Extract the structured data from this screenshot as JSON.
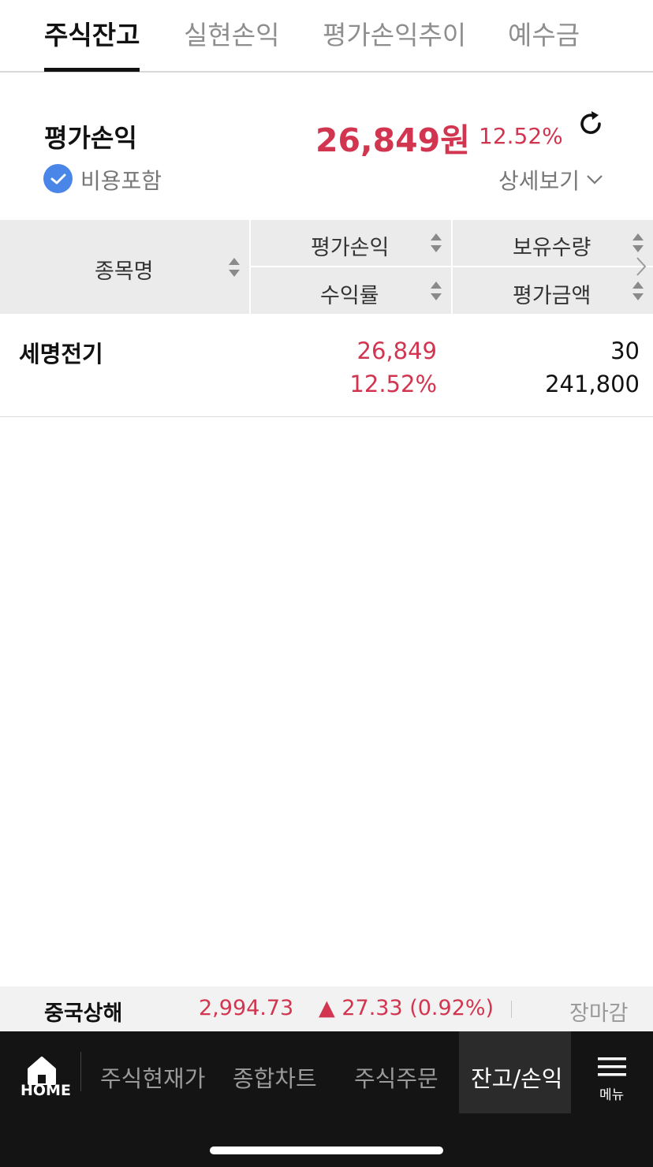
{
  "tabs": [
    "주식잔고",
    "실현손익",
    "평가손익추이",
    "예수금"
  ],
  "summary": {
    "title": "평가손익",
    "amount": "26,849원",
    "rate": "12.52%",
    "include_fee_label": "비용포함",
    "detail_label": "상세보기"
  },
  "table": {
    "headers": {
      "name": "종목명",
      "eval_pl": "평가손익",
      "return_rate": "수익률",
      "quantity": "보유수량",
      "eval_amount": "평가금액"
    },
    "rows": [
      {
        "name": "세명전기",
        "eval_pl": "26,849",
        "return_rate": "12.52%",
        "quantity": "30",
        "eval_amount": "241,800"
      }
    ]
  },
  "market": {
    "index_name": "중국상해",
    "value": "2,994.73",
    "change": "▲ 27.33 (0.92%)",
    "status": "장마감"
  },
  "nav": {
    "home": "HOME",
    "items": [
      "주식현재가",
      "종합차트",
      "주식주문",
      "잔고/손익"
    ],
    "menu": "메뉴"
  },
  "colors": {
    "up": "#d2354f",
    "accent": "#4a86e8"
  }
}
